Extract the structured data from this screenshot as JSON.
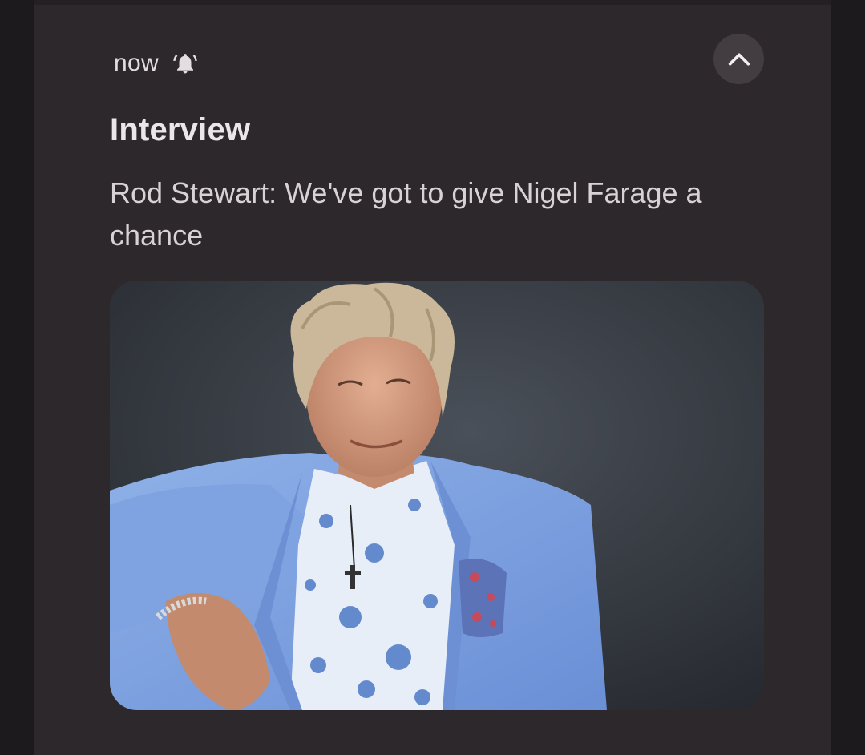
{
  "notification": {
    "time": "now",
    "alert_icon": "bell-ring-icon",
    "collapse_icon": "chevron-up-icon",
    "title": "Interview",
    "body": "Rod Stewart: We've got to give Nigel Farage a chance",
    "image_alt": "Rod Stewart portrait"
  },
  "colors": {
    "background": "#1c1a1d",
    "card": "#2d282c",
    "button": "#433c41",
    "text_primary": "#ebe6ea",
    "text_secondary": "#d8d2d6"
  }
}
